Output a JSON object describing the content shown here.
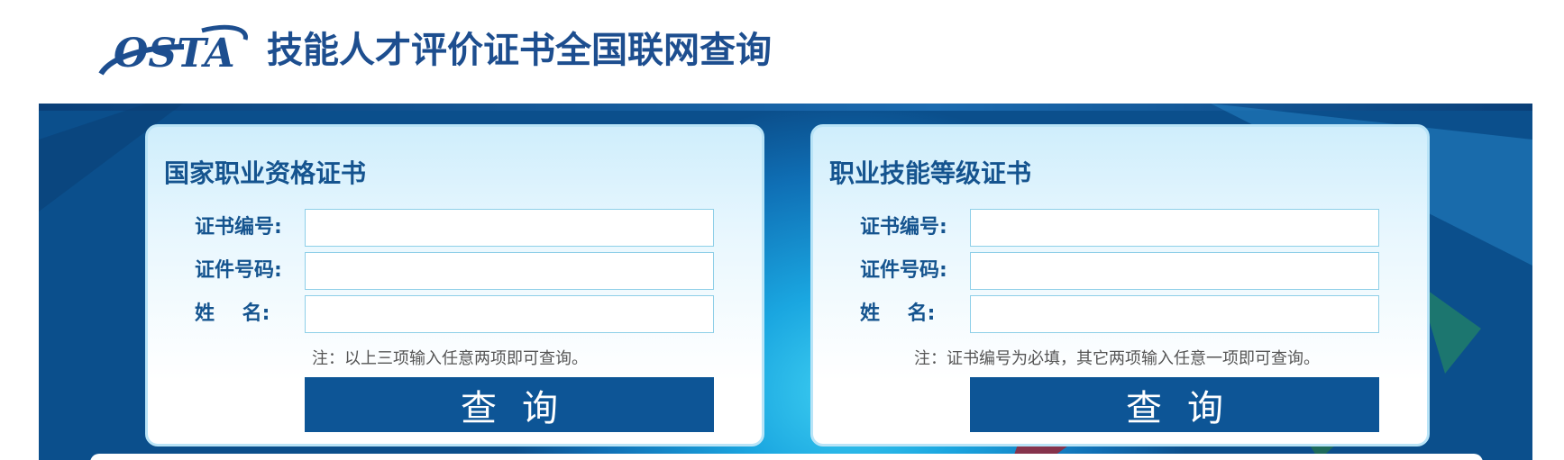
{
  "header": {
    "logo_text": "OSTA",
    "title": "技能人才评价证书全国联网查询"
  },
  "cards": [
    {
      "title": "国家职业资格证书",
      "fields": [
        {
          "label": "证书编号:",
          "value": "",
          "placeholder": ""
        },
        {
          "label": "证件号码:",
          "value": "",
          "placeholder": ""
        },
        {
          "label": "姓    名:",
          "value": "",
          "placeholder": ""
        }
      ],
      "note": "注：以上三项输入任意两项即可查询。",
      "button_label": "查询"
    },
    {
      "title": "职业技能等级证书",
      "fields": [
        {
          "label": "证书编号:",
          "value": "",
          "placeholder": ""
        },
        {
          "label": "证件号码:",
          "value": "",
          "placeholder": ""
        },
        {
          "label": "姓    名:",
          "value": "",
          "placeholder": ""
        }
      ],
      "note": "注：证书编号为必填，其它两项输入任意一项即可查询。",
      "button_label": "查询"
    }
  ],
  "colors": {
    "brand": "#1d4e8f",
    "button": "#0d5596",
    "banner": "#1683c8"
  }
}
